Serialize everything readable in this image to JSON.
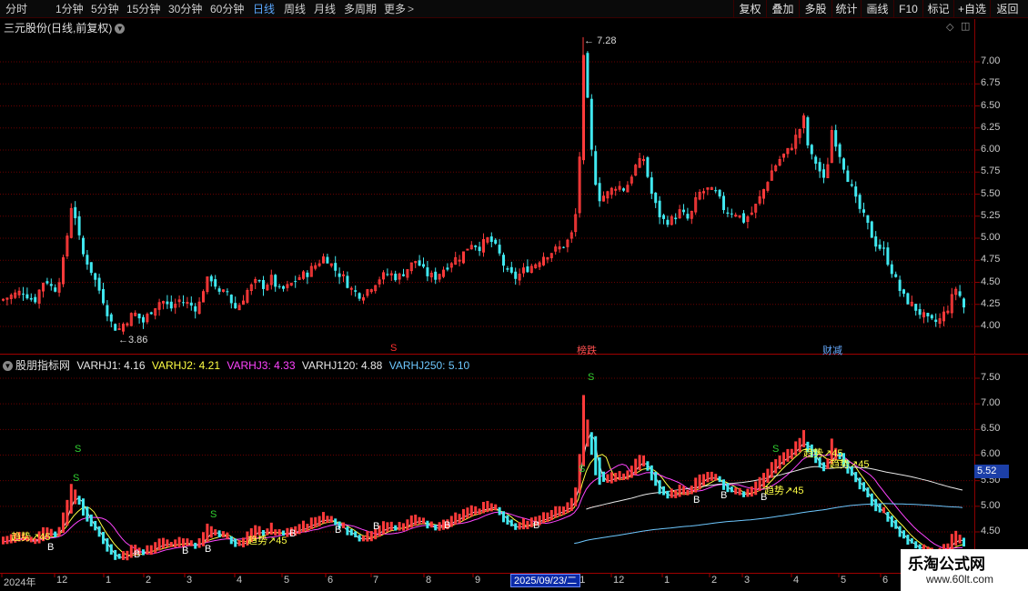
{
  "toolbar": {
    "periods": [
      "分时",
      "1分钟",
      "5分钟",
      "15分钟",
      "30分钟",
      "60分钟",
      "日线",
      "周线",
      "月线",
      "多周期",
      "更多"
    ],
    "active_period": "日线",
    "tools": [
      "复权",
      "叠加",
      "多股",
      "统计",
      "画线",
      "F10",
      "标记",
      "+自选",
      "返回"
    ]
  },
  "price_panel": {
    "title": "三元股份(日线,前复权)",
    "y_ticks": [
      "7.00",
      "6.75",
      "6.50",
      "6.25",
      "6.00",
      "5.75",
      "5.50",
      "5.25",
      "5.00",
      "4.75",
      "4.50",
      "4.25",
      "4.00"
    ],
    "high_label": "7.28",
    "low_label": "3.86",
    "markers": [
      {
        "text": "S",
        "color": "#ff3030"
      },
      {
        "text": "榜跌",
        "color": "#ff5050"
      },
      {
        "text": "财减",
        "color": "#66aaff"
      }
    ]
  },
  "indicator_panel": {
    "name": "股朋指标网",
    "values": [
      {
        "label": "VARHJ1: 4.16",
        "color": "#e8e8e8"
      },
      {
        "label": "VARHJ2: 4.21",
        "color": "#ffff44"
      },
      {
        "label": "VARHJ3: 4.33",
        "color": "#ff44ff"
      },
      {
        "label": "VARHJ120: 4.88",
        "color": "#e8e8e8"
      },
      {
        "label": "VARHJ250: 5.10",
        "color": "#6ec8ff"
      }
    ],
    "y_ticks": [
      "7.50",
      "7.00",
      "6.50",
      "6.00",
      "5.50",
      "5.00",
      "4.50"
    ],
    "current_value": "5.52",
    "trend_labels": [
      "趋势↗45",
      "趋势↗45",
      "趋势↗45",
      "趋势↗45",
      "趋势↗45"
    ]
  },
  "time_axis": {
    "labels": [
      "2024年",
      "12",
      "1",
      "2",
      "3",
      "4",
      "5",
      "6",
      "7",
      "8",
      "9",
      "11",
      "12",
      "1",
      "2",
      "3",
      "4",
      "5",
      "6"
    ],
    "selected_date": "2025/09/23/二"
  },
  "watermark": {
    "title": "乐淘公式网",
    "url": "www.60lt.com"
  },
  "colors": {
    "up": "#ff3a3a",
    "down": "#40e8f0",
    "grid": "#6a0000",
    "accent": "#5aa8ff"
  },
  "chart_data": {
    "type": "candlestick",
    "symbol": "三元股份",
    "period": "日线",
    "adjustment": "前复权",
    "close_path": [
      [
        0,
        4.3
      ],
      [
        12,
        4.35
      ],
      [
        24,
        4.4
      ],
      [
        36,
        4.28
      ],
      [
        48,
        4.55
      ],
      [
        58,
        4.4
      ],
      [
        66,
        4.6
      ],
      [
        72,
        5.0
      ],
      [
        78,
        5.45
      ],
      [
        82,
        5.2
      ],
      [
        88,
        4.85
      ],
      [
        96,
        4.7
      ],
      [
        104,
        4.5
      ],
      [
        112,
        4.3
      ],
      [
        120,
        4.05
      ],
      [
        128,
        3.95
      ],
      [
        136,
        4.05
      ],
      [
        146,
        4.15
      ],
      [
        156,
        4.05
      ],
      [
        166,
        4.2
      ],
      [
        176,
        4.3
      ],
      [
        186,
        4.2
      ],
      [
        196,
        4.3
      ],
      [
        206,
        4.25
      ],
      [
        216,
        4.2
      ],
      [
        224,
        4.5
      ],
      [
        232,
        4.55
      ],
      [
        240,
        4.35
      ],
      [
        248,
        4.4
      ],
      [
        256,
        4.2
      ],
      [
        262,
        4.25
      ],
      [
        270,
        4.4
      ],
      [
        280,
        4.5
      ],
      [
        290,
        4.45
      ],
      [
        296,
        4.55
      ],
      [
        306,
        4.4
      ],
      [
        316,
        4.45
      ],
      [
        326,
        4.55
      ],
      [
        336,
        4.6
      ],
      [
        346,
        4.7
      ],
      [
        356,
        4.8
      ],
      [
        366,
        4.65
      ],
      [
        376,
        4.55
      ],
      [
        386,
        4.4
      ],
      [
        396,
        4.35
      ],
      [
        406,
        4.45
      ],
      [
        416,
        4.55
      ],
      [
        426,
        4.6
      ],
      [
        436,
        4.55
      ],
      [
        446,
        4.65
      ],
      [
        456,
        4.75
      ],
      [
        466,
        4.6
      ],
      [
        476,
        4.55
      ],
      [
        486,
        4.65
      ],
      [
        496,
        4.75
      ],
      [
        506,
        4.8
      ],
      [
        516,
        4.95
      ],
      [
        526,
        4.9
      ],
      [
        536,
        5.0
      ],
      [
        546,
        4.85
      ],
      [
        556,
        4.6
      ],
      [
        566,
        4.55
      ],
      [
        576,
        4.65
      ],
      [
        586,
        4.7
      ],
      [
        596,
        4.8
      ],
      [
        606,
        4.85
      ],
      [
        616,
        4.9
      ],
      [
        626,
        5.0
      ],
      [
        632,
        5.3
      ],
      [
        636,
        6.0
      ],
      [
        641,
        7.28
      ],
      [
        646,
        6.2
      ],
      [
        651,
        5.8
      ],
      [
        656,
        5.45
      ],
      [
        666,
        5.5
      ],
      [
        676,
        5.6
      ],
      [
        686,
        5.55
      ],
      [
        696,
        5.8
      ],
      [
        706,
        5.9
      ],
      [
        716,
        5.45
      ],
      [
        726,
        5.2
      ],
      [
        736,
        5.2
      ],
      [
        746,
        5.3
      ],
      [
        756,
        5.2
      ],
      [
        766,
        5.5
      ],
      [
        776,
        5.55
      ],
      [
        786,
        5.5
      ],
      [
        796,
        5.3
      ],
      [
        806,
        5.3
      ],
      [
        816,
        5.2
      ],
      [
        826,
        5.3
      ],
      [
        836,
        5.5
      ],
      [
        846,
        5.75
      ],
      [
        856,
        5.9
      ],
      [
        866,
        6.0
      ],
      [
        876,
        6.2
      ],
      [
        882,
        6.35
      ],
      [
        888,
        5.95
      ],
      [
        896,
        5.85
      ],
      [
        906,
        5.6
      ],
      [
        912,
        6.25
      ],
      [
        920,
        6.0
      ],
      [
        930,
        5.7
      ],
      [
        940,
        5.4
      ],
      [
        950,
        5.2
      ],
      [
        960,
        4.95
      ],
      [
        970,
        4.85
      ],
      [
        980,
        4.6
      ],
      [
        990,
        4.35
      ],
      [
        1000,
        4.25
      ],
      [
        1010,
        4.15
      ],
      [
        1020,
        4.05
      ],
      [
        1030,
        4.05
      ],
      [
        1040,
        4.2
      ],
      [
        1050,
        4.45
      ],
      [
        1062,
        4.1
      ]
    ],
    "ma_lines": [
      {
        "name": "VARHJ1",
        "color": "#e8e8e8"
      },
      {
        "name": "VARHJ2",
        "color": "#ffff44"
      },
      {
        "name": "VARHJ3",
        "color": "#ff44ff"
      },
      {
        "name": "VARHJ120",
        "color": "#e8e8e8"
      },
      {
        "name": "VARHJ250",
        "color": "#6ec8ff"
      }
    ]
  }
}
